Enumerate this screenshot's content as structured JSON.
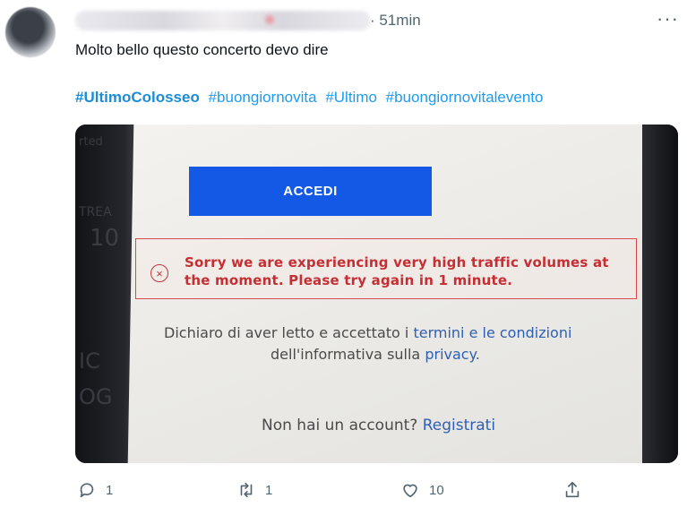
{
  "tweet": {
    "time": "· 51min",
    "more_glyph": "···",
    "text": "Molto bello questo concerto devo dire",
    "hashtags": [
      "#UltimoColosseo",
      "#buongiornovita",
      "#Ultimo",
      "#buongiornovitalevento"
    ]
  },
  "photo": {
    "accedi_label": "ACCEDI",
    "error_icon_glyph": "×",
    "error_message": "Sorry we are experiencing very high traffic volumes at the moment. Please try again in 1 minute.",
    "consent_line1_text": "Dichiaro di aver letto e accettato i",
    "consent_line1_link": "termini e le condizioni",
    "consent_line2_text": "dell'informativa sulla",
    "consent_line2_link": "privacy.",
    "signup_text": "Non hai un account?",
    "signup_link": "Registrati",
    "left_edge_fragments": [
      "rted",
      "TREA",
      "10",
      "IC",
      "OG"
    ]
  },
  "actions": {
    "reply_count": "1",
    "retweet_count": "1",
    "like_count": "10"
  },
  "colors": {
    "hashtag": "#1d9bf0",
    "accedi_button": "#1459e6",
    "error": "#c42f34",
    "link_in_photo": "#2f5fb3",
    "muted": "#536471"
  }
}
